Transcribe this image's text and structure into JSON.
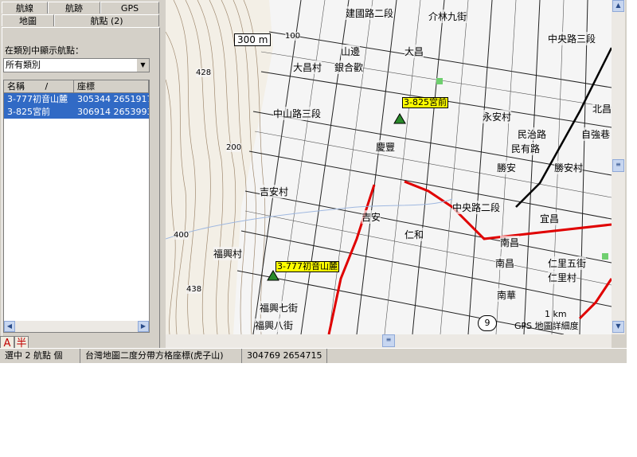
{
  "sidebar": {
    "tabs_row1": [
      "航線",
      "航跡",
      "GPS"
    ],
    "tabs_row2": [
      "地圖",
      "航點 (2)"
    ],
    "filter_label": "在類別中顯示航點：",
    "category_select": "所有類別",
    "columns": [
      "名稱",
      "座標"
    ],
    "sort_marker": "/",
    "waypoints": [
      {
        "name": "3-777初音山麓",
        "coord": "305344 2651917"
      },
      {
        "name": "3-825宮前",
        "coord": "306914 2653993"
      }
    ]
  },
  "ime": {
    "a": "A",
    "half": "半"
  },
  "status": {
    "waypoint_count": "選中 2 航點 個",
    "grid_system": "台灣地圖二度分帶方格座標(虎子山)",
    "cursor_coord": "304769 2654715"
  },
  "map": {
    "scale_300": "300 m",
    "scale_1km": "1 km",
    "route_button": "9",
    "detail_label": "GPS 地圖詳細度",
    "waypoint_labels": [
      "3-825宮前",
      "3-777初音山麓"
    ],
    "roads": [
      "建國路二段",
      "介林九街",
      "大昌",
      "中山路三段",
      "永安村",
      "民治路",
      "民有路",
      "自強巷",
      "慶豐",
      "勝安",
      "勝安村",
      "吉安村",
      "中央路二段",
      "北昌",
      "宜昌",
      "南昌",
      "仁里五街",
      "仁里村",
      "福興村",
      "吉安",
      "仁和",
      "南華",
      "山邊",
      "大昌村",
      "銀合歡",
      "中央路三段",
      "福興八街",
      "福興七街",
      "南昌"
    ],
    "contours": [
      "428",
      "200",
      "400",
      "438",
      "100"
    ]
  }
}
